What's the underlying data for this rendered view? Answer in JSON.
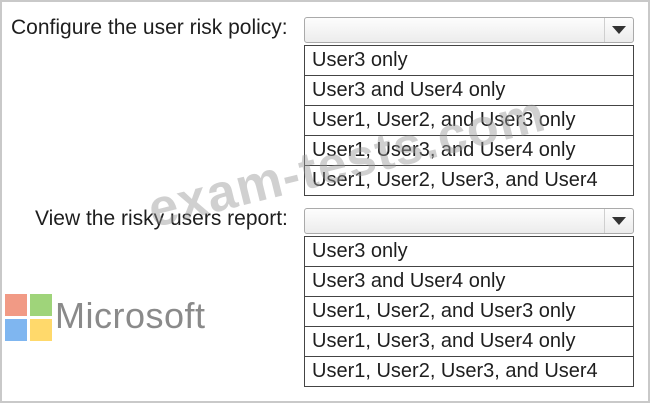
{
  "sections": [
    {
      "label": "Configure the user risk policy:",
      "selected": "",
      "options": [
        "User3 only",
        "User3 and User4 only",
        "User1, User2, and User3 only",
        "User1, User3, and User4 only",
        "User1, User2, User3, and User4"
      ]
    },
    {
      "label": "View the risky users report:",
      "selected": "",
      "options": [
        "User3 only",
        "User3 and User4 only",
        "User1, User2, and User3 only",
        "User1, User3, and User4 only",
        "User1, User2, User3, and User4"
      ]
    }
  ],
  "branding": {
    "logo_text": "Microsoft"
  },
  "watermark": "exam-tests.com",
  "colors": {
    "logo_red": "#f19a85",
    "logo_green": "#9fd47a",
    "logo_blue": "#7fb6f0",
    "logo_yellow": "#ffd96b"
  }
}
